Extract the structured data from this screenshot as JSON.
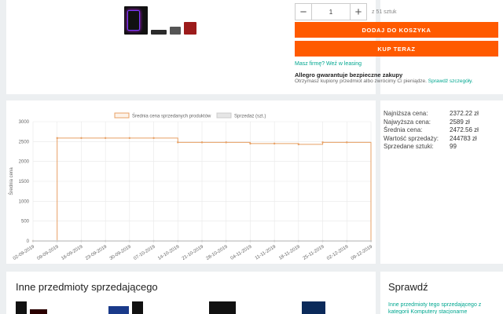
{
  "product": {
    "quantity": {
      "minus": "−",
      "value": "1",
      "plus": "+",
      "available": "z 51 sztuk"
    },
    "add_to_cart": "DODAJ DO KOSZYKA",
    "buy_now": "KUP TERAZ",
    "leasing": "Masz firmę? Weź w leasing",
    "guarantee_title": "Allegro gwarantuje bezpieczne zakupy",
    "guarantee_text": "Otrzymasz kupiony przedmiot albo zwrócimy Ci pieniądze.",
    "guarantee_link": "Sprawdź szczegóły."
  },
  "chart_data": {
    "type": "line",
    "legend": [
      "Średnia cena sprzedanych produktów",
      "Sprzedaż (szt.)"
    ],
    "ylabel": "Średnia cena",
    "ylim": [
      0,
      3000
    ],
    "yticks": [
      "0",
      "500",
      "1000",
      "1500",
      "2000",
      "2500",
      "3000"
    ],
    "x_labels": [
      "02-09-2019",
      "09-09-2019",
      "16-09-2019",
      "23-09-2019",
      "30-09-2019",
      "07-10-2019",
      "14-10-2019",
      "21-10-2019",
      "28-10-2019",
      "04-11-2019",
      "11-11-2019",
      "18-11-2019",
      "25-11-2019",
      "02-12-2019",
      "09-12-2019"
    ],
    "series": [
      {
        "name": "Średnia cena sprzedanych produktów",
        "color": "#e8a064",
        "values": [
          0,
          2589,
          2589,
          2589,
          2589,
          2589,
          2480,
          2480,
          2480,
          2450,
          2450,
          2430,
          2480,
          2480,
          0
        ]
      },
      {
        "name": "Sprzedaż (szt.)",
        "color": "#cccccc",
        "values": [
          0,
          0,
          0,
          0,
          0,
          0,
          0,
          0,
          0,
          0,
          0,
          0,
          0,
          0,
          0
        ]
      }
    ]
  },
  "stats": [
    {
      "label": "Najniższa cena:",
      "value": "2372.22 zł"
    },
    {
      "label": "Najwyższa cena:",
      "value": "2589 zł"
    },
    {
      "label": "Średnia cena:",
      "value": "2472.56 zł"
    },
    {
      "label": "Wartość sprzedaży:",
      "value": "244783 zł"
    },
    {
      "label": "Sprzedane sztuki:",
      "value": "99"
    }
  ],
  "seller_items_title": "Inne przedmioty sprzedającego",
  "sprawdz": {
    "title": "Sprawdź",
    "link": "Inne przedmioty tego sprzedającego z kategorii Komputery stacjonarne"
  }
}
